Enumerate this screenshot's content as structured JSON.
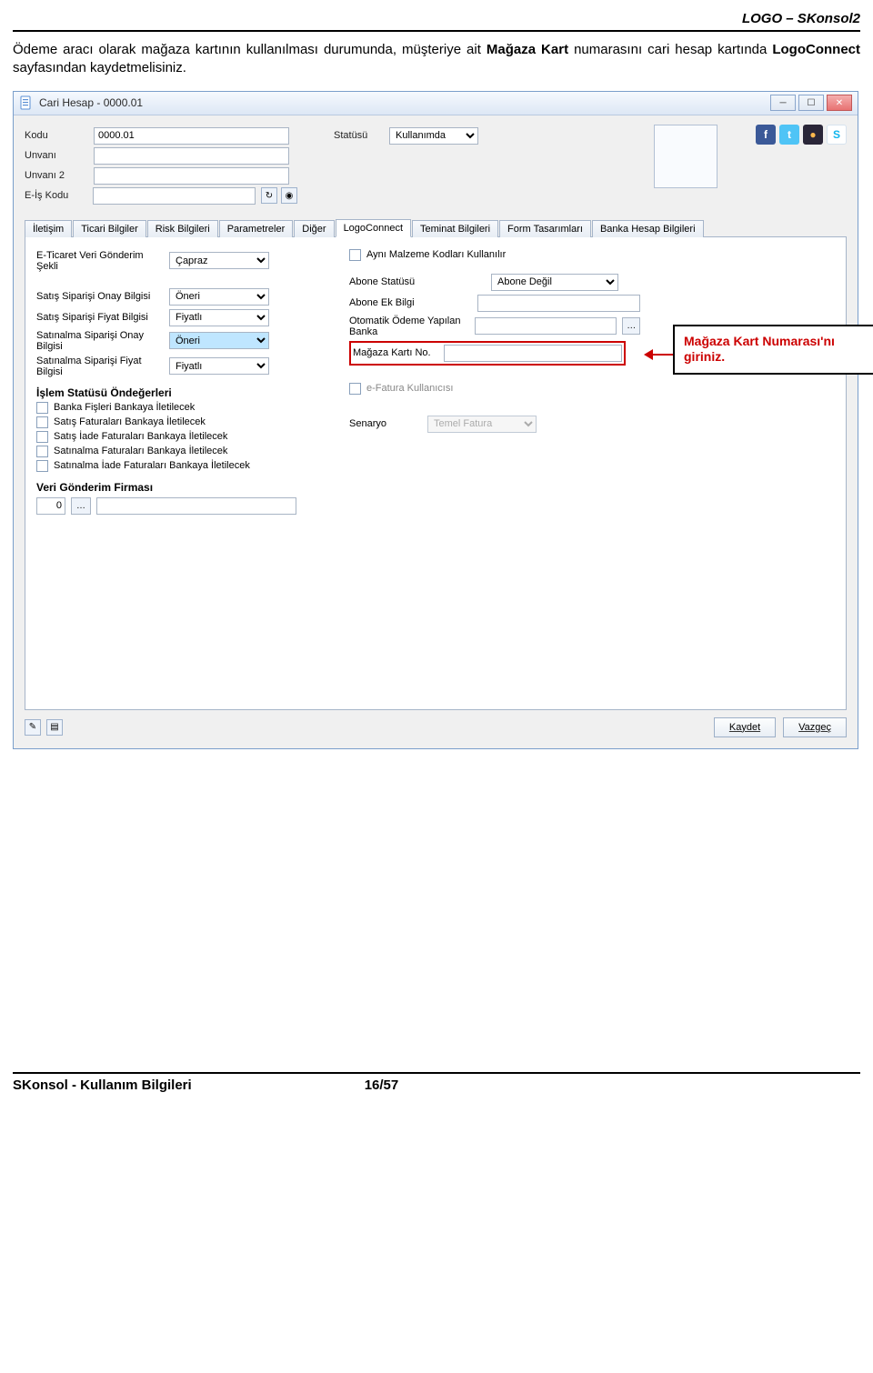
{
  "doc": {
    "header_brand": "LOGO – SKonsol2",
    "intro_pre": "Ödeme aracı olarak mağaza kartının kullanılması durumunda, müşteriye ait ",
    "intro_bold1": "Mağaza Kart",
    "intro_mid": " numarasını cari hesap kartında ",
    "intro_bold2": "LogoConnect",
    "intro_post": " sayfasından kaydetmelisiniz.",
    "footer_left": "SKonsol - Kullanım Bilgileri",
    "footer_page": "16/57"
  },
  "window": {
    "title": "Cari Hesap - 0000.01"
  },
  "topform": {
    "kodu_lbl": "Kodu",
    "kodu_val": "0000.01",
    "unvani_lbl": "Unvanı",
    "unvani_val": "",
    "unvani2_lbl": "Unvanı 2",
    "unvani2_val": "",
    "eis_lbl": "E-İş Kodu",
    "eis_val": "",
    "statu_lbl": "Statüsü",
    "statu_val": "Kullanımda"
  },
  "tabs": {
    "items": [
      {
        "label": "İletişim"
      },
      {
        "label": "Ticari Bilgiler"
      },
      {
        "label": "Risk Bilgileri"
      },
      {
        "label": "Parametreler"
      },
      {
        "label": "Diğer"
      },
      {
        "label": "LogoConnect"
      },
      {
        "label": "Teminat Bilgileri"
      },
      {
        "label": "Form Tasarımları"
      },
      {
        "label": "Banka Hesap Bilgileri"
      }
    ],
    "active_index": 5
  },
  "logoConnect": {
    "eticaret_lbl": "E-Ticaret Veri Gönderim Şekli",
    "eticaret_val": "Çapraz",
    "ayni_malzeme_lbl": "Aynı Malzeme Kodları Kullanılır",
    "satis_onay_lbl": "Satış Siparişi Onay Bilgisi",
    "satis_onay_val": "Öneri",
    "satis_fiyat_lbl": "Satış Siparişi Fiyat Bilgisi",
    "satis_fiyat_val": "Fiyatlı",
    "satinalma_onay_lbl": "Satınalma Siparişi Onay Bilgisi",
    "satinalma_onay_val": "Öneri",
    "satinalma_fiyat_lbl": "Satınalma Siparişi Fiyat Bilgisi",
    "satinalma_fiyat_val": "Fiyatlı",
    "abone_statu_lbl": "Abone Statüsü",
    "abone_statu_val": "Abone Değil",
    "abone_ek_lbl": "Abone Ek Bilgi",
    "abone_ek_val": "",
    "otomatik_banka_lbl": "Otomatik Ödeme Yapılan Banka",
    "otomatik_banka_val": "",
    "magaza_lbl": "Mağaza Kartı No.",
    "magaza_val": "",
    "islem_statu_head": "İşlem Statüsü Öndeğerleri",
    "chk1": "Banka Fişleri Bankaya İletilecek",
    "chk2": "Satış Faturaları Bankaya İletilecek",
    "chk3": "Satış İade Faturaları Bankaya İletilecek",
    "chk4": "Satınalma Faturaları Bankaya İletilecek",
    "chk5": "Satınalma İade Faturaları Bankaya İletilecek",
    "efatura_lbl": "e-Fatura Kullanıcısı",
    "senaryo_lbl": "Senaryo",
    "senaryo_val": "Temel Fatura",
    "veri_firma_head": "Veri Gönderim Firması",
    "veri_firma_no": "0"
  },
  "callout": {
    "text": "Mağaza Kart Numarası'nı giriniz."
  },
  "buttons": {
    "kaydet": "Kaydet",
    "vazgec": "Vazgeç"
  }
}
